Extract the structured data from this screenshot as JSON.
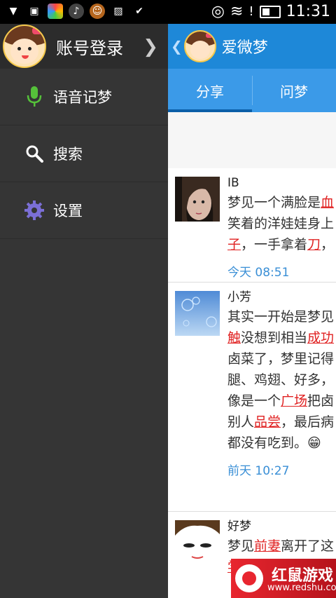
{
  "status": {
    "time": "11:31"
  },
  "drawer": {
    "login_label": "账号登录",
    "items": [
      {
        "label": "语音记梦",
        "icon": "microphone-icon"
      },
      {
        "label": "搜索",
        "icon": "search-icon"
      },
      {
        "label": "设置",
        "icon": "gear-icon"
      }
    ]
  },
  "app": {
    "title": "爱微梦"
  },
  "tabs": [
    {
      "label": "分享"
    },
    {
      "label": "问梦"
    }
  ],
  "posts": [
    {
      "author": "IB",
      "lines": [
        [
          "梦见一个满脸是",
          [
            "血",
            true
          ]
        ],
        [
          "笑着的洋娃娃身上"
        ],
        [
          [
            "子",
            true
          ],
          "，一手拿着",
          [
            "刀",
            true
          ],
          "，"
        ]
      ],
      "time": "今天 08:51"
    },
    {
      "author": "小芳",
      "lines": [
        [
          "其实一开始是梦见"
        ],
        [
          [
            "触",
            true
          ],
          "没想到相当",
          [
            "成功",
            true
          ]
        ],
        [
          "卤菜了，梦里记得"
        ],
        [
          "腿、鸡翅、好多，"
        ],
        [
          "像是一个",
          [
            "广场",
            true
          ],
          "把卤"
        ],
        [
          "别人",
          [
            "品尝",
            true
          ],
          "，最后病"
        ],
        [
          "都没有吃到。😁"
        ]
      ],
      "time": "前天 10:27"
    },
    {
      "author": "好梦",
      "lines": [
        [
          "梦见",
          [
            "前妻",
            true
          ],
          "离开了这"
        ],
        [
          [
            "学",
            true
          ],
          "会"
        ]
      ],
      "time": ""
    }
  ],
  "watermark": {
    "title": "红鼠游戏",
    "url": "www.redshu.com"
  },
  "colors": {
    "topbar": "#1e88d8",
    "tabs": "#3b9ae8",
    "drawer": "#353535",
    "highlight": "#e02222",
    "time": "#3a8fd6"
  }
}
